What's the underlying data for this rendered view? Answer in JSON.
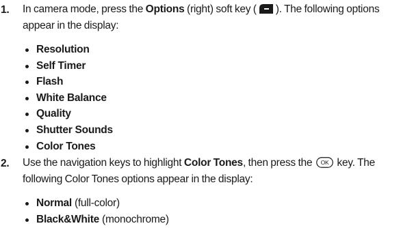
{
  "step1": {
    "number": "1.",
    "text_before": "In camera mode, press the ",
    "key_name": "Options",
    "text_mid": " (right) soft key (",
    "text_after": "). The following options appear in the display:",
    "softkey_icon": "right-soft-key-icon",
    "options": [
      "Resolution",
      "Self Timer",
      "Flash",
      "White Balance",
      "Quality",
      "Shutter Sounds",
      "Color Tones"
    ]
  },
  "step2": {
    "number": "2.",
    "text_before": "Use the navigation keys to highlight ",
    "highlight_name": "Color Tones",
    "text_mid": ", then press the ",
    "ok_key_label": "OK",
    "text_after": " key. The following Color Tones options appear in the display:",
    "options": [
      {
        "name": "Normal",
        "note": " (full-color)"
      },
      {
        "name": "Black&White",
        "note": " (monochrome)"
      }
    ]
  }
}
